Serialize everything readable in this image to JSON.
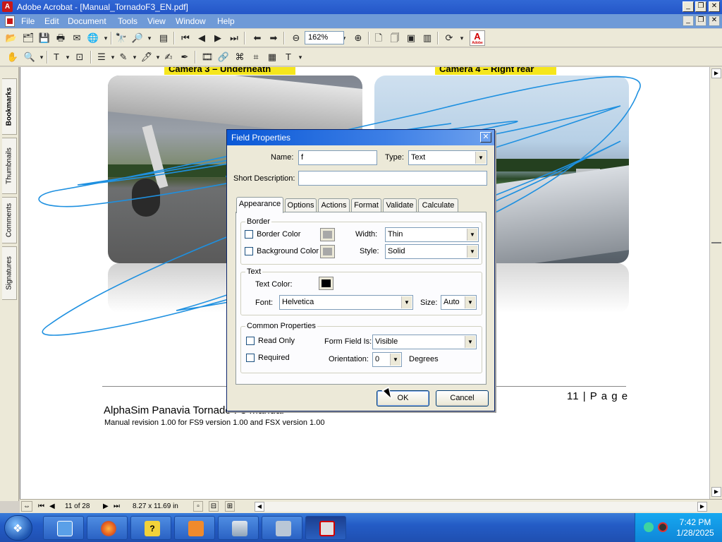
{
  "window": {
    "title": "Adobe Acrobat - [Manual_TornadoF3_EN.pdf]",
    "minimize": "_",
    "restore": "❐",
    "close": "✕"
  },
  "menu": {
    "items": [
      {
        "label": "File"
      },
      {
        "label": "Edit"
      },
      {
        "label": "Document"
      },
      {
        "label": "Tools"
      },
      {
        "label": "View"
      },
      {
        "label": "Window"
      },
      {
        "label": "Help"
      }
    ]
  },
  "toolbar": {
    "zoom": "162%",
    "adobe_logo": "A",
    "adobe_text": "Adobe"
  },
  "nav_tabs": [
    {
      "label": "Bookmarks"
    },
    {
      "label": "Thumbnails"
    },
    {
      "label": "Comments"
    },
    {
      "label": "Signatures"
    }
  ],
  "page": {
    "caption_left": "Camera 3 –  Underneath",
    "caption_right": "Camera 4 –  Right rear",
    "page_number": "11 | P a g e",
    "footer_title": "AlphaSim Panavia Tornado F3 Manual",
    "footer_revision": "Manual revision 1.00 for FS9 version 1.00 and FSX version 1.00"
  },
  "statusbar": {
    "page_indicator": "11 of 28",
    "page_size": "8.27 x 11.69 in"
  },
  "dialog": {
    "title": "Field Properties",
    "name_label": "Name:",
    "name_value": "f",
    "type_label": "Type:",
    "type_value": "Text",
    "short_desc_label": "Short Description:",
    "short_desc_value": "",
    "tabs": [
      {
        "label": "Appearance"
      },
      {
        "label": "Options"
      },
      {
        "label": "Actions"
      },
      {
        "label": "Format"
      },
      {
        "label": "Validate"
      },
      {
        "label": "Calculate"
      }
    ],
    "border_group": "Border",
    "border_color_label": "Border Color",
    "background_color_label": "Background Color",
    "width_label": "Width:",
    "width_value": "Thin",
    "style_label": "Style:",
    "style_value": "Solid",
    "text_group": "Text",
    "text_color_label": "Text Color:",
    "font_label": "Font:",
    "font_value": "Helvetica",
    "size_label": "Size:",
    "size_value": "Auto",
    "common_group": "Common Properties",
    "read_only_label": "Read Only",
    "required_label": "Required",
    "form_field_label": "Form Field Is:",
    "form_field_value": "Visible",
    "orientation_label": "Orientation:",
    "orientation_value": "0",
    "degrees_label": "Degrees",
    "ok_label": "OK",
    "cancel_label": "Cancel",
    "colors": {
      "border_swatch": "#a8a8a8",
      "background_swatch": "#a8a8a8",
      "text_swatch": "#000000"
    }
  },
  "taskbar": {
    "time": "7:42 PM",
    "date": "1/28/2025"
  },
  "colors": {
    "titlebar": "#2456c8",
    "scribble": "#1e90e0",
    "caption": "#f5e61d",
    "taskbar": "#245cc6"
  }
}
